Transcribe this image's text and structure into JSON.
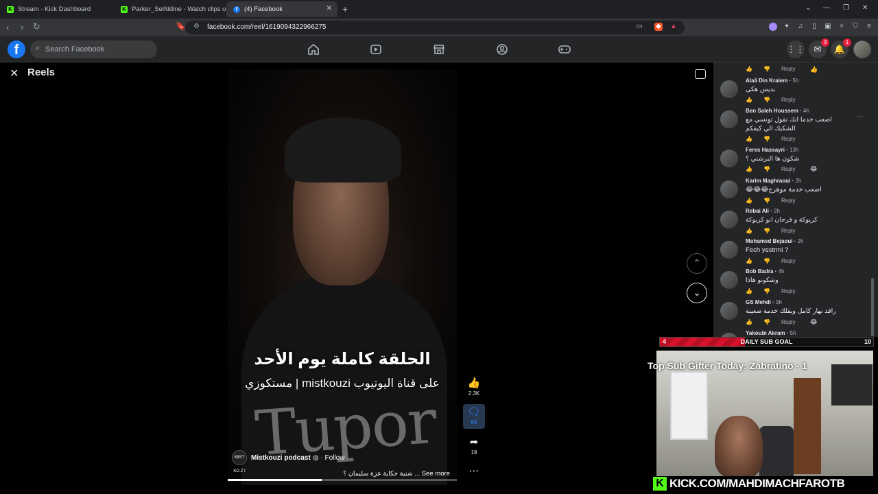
{
  "browser": {
    "tabs": [
      {
        "label": "Stream - Kick Dashboard",
        "favicon": "kick-icon",
        "active": false
      },
      {
        "label": "Parker_Seifddine - Watch clips on Kic",
        "favicon": "kick-icon",
        "active": false
      },
      {
        "label": "(4) Facebook",
        "favicon": "facebook-icon",
        "active": true
      }
    ],
    "url": "facebook.com/reel/1619094322966275"
  },
  "facebook": {
    "search_placeholder": "Search Facebook",
    "messenger_badge": "3",
    "notifications_badge": "1",
    "accent": "#1877f2"
  },
  "reel": {
    "title": "Reels",
    "subtitle_main": "الحلقة كاملة يوم الأحد",
    "subtitle_second": "على قناة اليوتيوب mistkouzi | مستكوزي",
    "owner_logo": "MIST KO Z I",
    "owner_name": "Mistkouzi podcast",
    "follow": "· Follow",
    "description": "شنية حكاية عزة سليمان ؟ ... See more",
    "likes": "2.3K",
    "comments_count": "64",
    "shares": "18",
    "progress": 0.41
  },
  "comments": {
    "reply_label": "Reply",
    "items": [
      {
        "name": "Alaâ Din Kraiem",
        "time": "5h",
        "text": "بديس هكى"
      },
      {
        "name": "Ben Saleh Houssem",
        "time": "4h",
        "text": "اصعب خدما انك تقول تونسي مع الشكبك الي كيفكم"
      },
      {
        "name": "Feres Hassayri",
        "time": "13h",
        "text": "شكون ها البرشني ؟",
        "reaction": "😂"
      },
      {
        "name": "Karim Maghraoui",
        "time": "2h",
        "text": "اصعب خدمة موهرج😂😂😂"
      },
      {
        "name": "Rebai Ali",
        "time": "2h",
        "text": "كريوكة و فرحان انو كريوكة"
      },
      {
        "name": "Mohamed Bejaoui",
        "time": "2h",
        "text": "Fech yestrmi ?"
      },
      {
        "name": "Bob Badra",
        "time": "4h",
        "text": "وشكونو هاذا"
      },
      {
        "name": "GS Mehdi",
        "time": "9h",
        "text": "راقد نهار كامل ويقلك خدمة صعيبة",
        "reaction": "😂"
      },
      {
        "name": "Yakoubi Akram",
        "time": "5h",
        "text": ""
      }
    ]
  },
  "stream_overlay": {
    "goal_label": "DAILY SUB GOAL",
    "goal_current": "4",
    "goal_target": "10",
    "goal_progress": 0.4,
    "top_gifter": "Top Sub Gifter Today: Zabratino - 1",
    "kick_url": "KICK.COM/MAHDIMACHFAROTB",
    "kick_color": "#53fc18"
  }
}
